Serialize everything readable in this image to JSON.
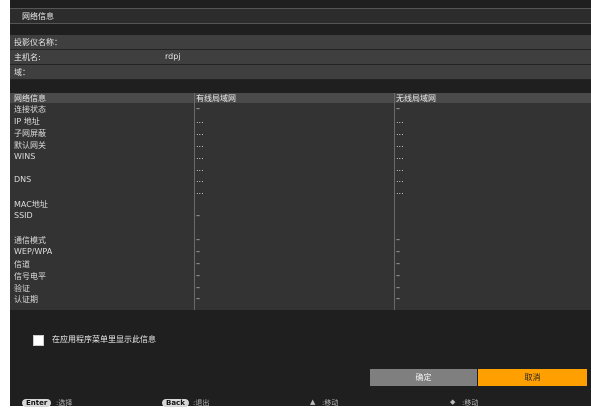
{
  "title": "网络信息",
  "info": {
    "projector_name_label": "投影仪名称：",
    "hostname_label": "主机名:",
    "hostname_value": "rdpj",
    "domain_label": "域："
  },
  "table": {
    "headers": [
      "网络信息",
      "有线局域网",
      "无线局域网"
    ],
    "rows": [
      {
        "label": "连接状态",
        "wired": "–",
        "wireless": "–"
      },
      {
        "label": "IP 地址",
        "wired": "...",
        "wireless": "..."
      },
      {
        "label": "子网屏蔽",
        "wired": "...",
        "wireless": "..."
      },
      {
        "label": "默认网关",
        "wired": "...",
        "wireless": "..."
      },
      {
        "label": "WINS",
        "wired": "...",
        "wireless": "..."
      },
      {
        "label": "",
        "wired": "...",
        "wireless": "..."
      },
      {
        "label": "DNS",
        "wired": "...",
        "wireless": "..."
      },
      {
        "label": "",
        "wired": "...",
        "wireless": "..."
      },
      {
        "label": "MAC地址",
        "wired": "",
        "wireless": ""
      },
      {
        "label": "SSID",
        "wired": "–",
        "wireless": ""
      },
      {
        "label": "",
        "wired": "",
        "wireless": ""
      },
      {
        "label": "通信模式",
        "wired": "–",
        "wireless": "–"
      },
      {
        "label": "WEP/WPA",
        "wired": "–",
        "wireless": "–"
      },
      {
        "label": "信道",
        "wired": "–",
        "wireless": "–"
      },
      {
        "label": "信号电平",
        "wired": "–",
        "wireless": "–"
      },
      {
        "label": "验证",
        "wired": "–",
        "wireless": "–"
      },
      {
        "label": "认证期",
        "wired": "–",
        "wireless": "–"
      }
    ]
  },
  "checkbox_label": "在应用程序菜单里显示此信息",
  "buttons": {
    "ok": "确定",
    "cancel": "取消"
  },
  "footer": {
    "enter_key": "Enter",
    "enter_label": ":选择",
    "back_key": "Back",
    "back_label": ":退出",
    "move1_icon": "up-down-arrow-icon",
    "move1_label": ":移动",
    "move2_icon": "left-right-arrow-icon",
    "move2_label": ":移动"
  },
  "colors": {
    "accent": "#ffa000",
    "background": "#1f1f1f",
    "button": "#7f7f7f"
  }
}
